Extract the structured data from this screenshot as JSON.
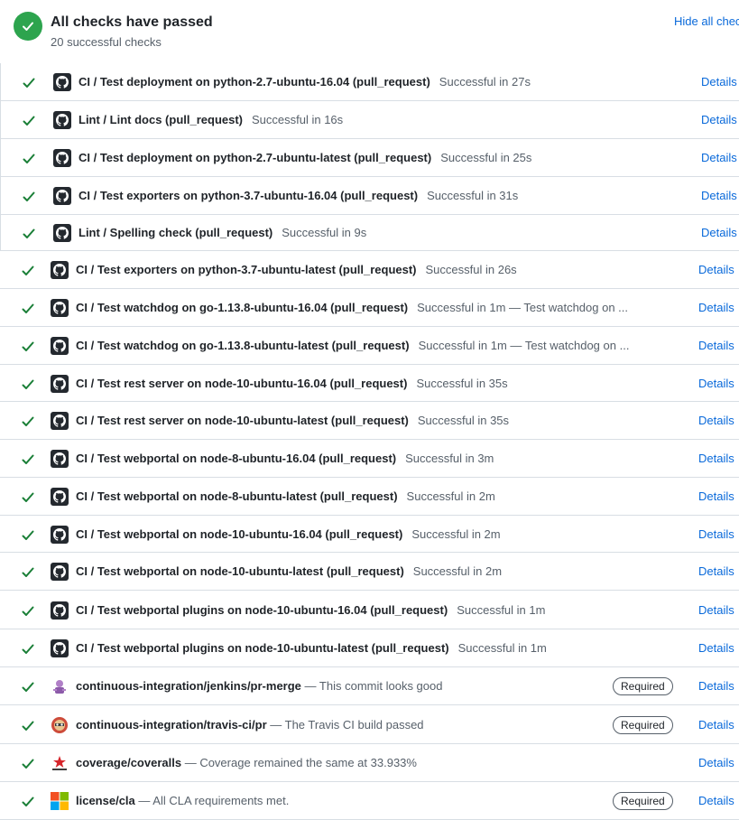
{
  "header": {
    "title": "All checks have passed",
    "subtitle": "20 successful checks",
    "hide_link": "Hide all checks"
  },
  "colors": {
    "success": "#1a7f37",
    "link": "#0969da",
    "muted": "#57606a",
    "header_icon": "#2da44e"
  },
  "checks": [
    {
      "name": "CI / Test deployment on python-2.7-ubuntu-16.04 (pull_request)",
      "desc": "Successful in 27s",
      "required": "",
      "details": "Details",
      "icon": "github-icon"
    },
    {
      "name": "Lint / Lint docs (pull_request)",
      "desc": "Successful in 16s",
      "required": "",
      "details": "Details",
      "icon": "github-icon"
    },
    {
      "name": "CI / Test deployment on python-2.7-ubuntu-latest (pull_request)",
      "desc": "Successful in 25s",
      "required": "",
      "details": "Details",
      "icon": "github-icon"
    },
    {
      "name": "CI / Test exporters on python-3.7-ubuntu-16.04 (pull_request)",
      "desc": "Successful in 31s",
      "required": "",
      "details": "Details",
      "icon": "github-icon"
    },
    {
      "name": "Lint / Spelling check (pull_request)",
      "desc": "Successful in 9s",
      "required": "",
      "details": "Details",
      "icon": "github-icon"
    },
    {
      "name": "CI / Test exporters on python-3.7-ubuntu-latest (pull_request)",
      "desc": "Successful in 26s",
      "required": "",
      "details": "Details",
      "icon": "github-icon"
    },
    {
      "name": "CI / Test watchdog on go-1.13.8-ubuntu-16.04 (pull_request)",
      "desc": "Successful in 1m — Test watchdog on ...",
      "required": "",
      "details": "Details",
      "icon": "github-icon"
    },
    {
      "name": "CI / Test watchdog on go-1.13.8-ubuntu-latest (pull_request)",
      "desc": "Successful in 1m — Test watchdog on ...",
      "required": "",
      "details": "Details",
      "icon": "github-icon"
    },
    {
      "name": "CI / Test rest server on node-10-ubuntu-16.04 (pull_request)",
      "desc": "Successful in 35s",
      "required": "",
      "details": "Details",
      "icon": "github-icon"
    },
    {
      "name": "CI / Test rest server on node-10-ubuntu-latest (pull_request)",
      "desc": "Successful in 35s",
      "required": "",
      "details": "Details",
      "icon": "github-icon"
    },
    {
      "name": "CI / Test webportal on node-8-ubuntu-16.04 (pull_request)",
      "desc": "Successful in 3m",
      "required": "",
      "details": "Details",
      "icon": "github-icon"
    },
    {
      "name": "CI / Test webportal on node-8-ubuntu-latest (pull_request)",
      "desc": "Successful in 2m",
      "required": "",
      "details": "Details",
      "icon": "github-icon"
    },
    {
      "name": "CI / Test webportal on node-10-ubuntu-16.04 (pull_request)",
      "desc": "Successful in 2m",
      "required": "",
      "details": "Details",
      "icon": "github-icon"
    },
    {
      "name": "CI / Test webportal on node-10-ubuntu-latest (pull_request)",
      "desc": "Successful in 2m",
      "required": "",
      "details": "Details",
      "icon": "github-icon"
    },
    {
      "name": "CI / Test webportal plugins on node-10-ubuntu-16.04 (pull_request)",
      "desc": "Successful in 1m",
      "required": "",
      "details": "Details",
      "icon": "github-icon"
    },
    {
      "name": "CI / Test webportal plugins on node-10-ubuntu-latest (pull_request)",
      "desc": "Successful in 1m",
      "required": "",
      "details": "Details",
      "icon": "github-icon"
    },
    {
      "name": "continuous-integration/jenkins/pr-merge",
      "desc": "— This commit looks good",
      "required": "Required",
      "details": "Details",
      "icon": "jenkins-icon"
    },
    {
      "name": "continuous-integration/travis-ci/pr",
      "desc": "— The Travis CI build passed",
      "required": "Required",
      "details": "Details",
      "icon": "travis-icon"
    },
    {
      "name": "coverage/coveralls",
      "desc": "— Coverage remained the same at 33.933%",
      "required": "",
      "details": "Details",
      "icon": "coveralls-icon"
    },
    {
      "name": "license/cla",
      "desc": "— All CLA requirements met.",
      "required": "Required",
      "details": "Details",
      "icon": "cla-icon"
    }
  ]
}
